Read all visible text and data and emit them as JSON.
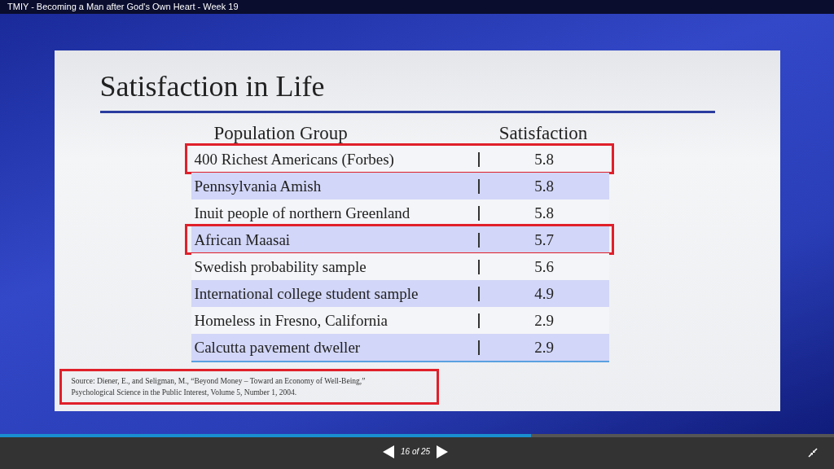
{
  "window": {
    "title": "TMIY - Becoming a Man after God's Own Heart - Week 19"
  },
  "slide": {
    "title": "Satisfaction in Life",
    "table": {
      "columns": [
        "Population Group",
        "Satisfaction"
      ],
      "rows": [
        {
          "group": "400 Richest Americans (Forbes)",
          "satisfaction": "5.8",
          "highlighted": true
        },
        {
          "group": "Pennsylvania Amish",
          "satisfaction": "5.8",
          "highlighted": false
        },
        {
          "group": "Inuit people of  northern Greenland",
          "satisfaction": "5.8",
          "highlighted": false
        },
        {
          "group": "African Maasai",
          "satisfaction": "5.7",
          "highlighted": true
        },
        {
          "group": "Swedish probability sample",
          "satisfaction": "5.6",
          "highlighted": false
        },
        {
          "group": "International college student sample",
          "satisfaction": "4.9",
          "highlighted": false
        },
        {
          "group": "Homeless in Fresno, California",
          "satisfaction": "2.9",
          "highlighted": false
        },
        {
          "group": "Calcutta pavement dweller",
          "satisfaction": "2.9",
          "highlighted": false
        }
      ]
    },
    "source": {
      "lines": [
        "Source: Diener, E., and Seligman, M., “Beyond Money – Toward an Economy of Well-Being,”",
        "Psychological Science in the Public Interest, Volume 5, Number 1, 2004."
      ],
      "highlighted": true
    }
  },
  "player": {
    "progress": {
      "level": 0.637
    },
    "counter": "16 of 25"
  }
}
